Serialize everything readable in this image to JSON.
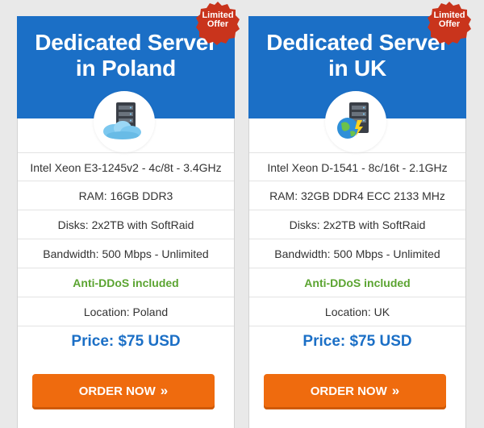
{
  "plans": [
    {
      "badge_line1": "Limited",
      "badge_line2": "Offer",
      "title_line1": "Dedicated Server",
      "title_line2": "in Poland",
      "icon": "server-cloud-icon",
      "specs": [
        "Intel Xeon E3-1245v2 - 4c/8t - 3.4GHz",
        "RAM: 16GB DDR3",
        "Disks: 2x2TB with SoftRaid",
        "Bandwidth: 500 Mbps - Unlimited",
        "Anti-DDoS included",
        "Location: Poland"
      ],
      "price": "Price: $75 USD",
      "order_label": "ORDER NOW",
      "order_chevron": "»"
    },
    {
      "badge_line1": "Limited",
      "badge_line2": "Offer",
      "title_line1": "Dedicated Server",
      "title_line2": "in UK",
      "icon": "server-globe-icon",
      "specs": [
        "Intel Xeon D-1541 - 8c/16t - 2.1GHz",
        "RAM: 32GB DDR4 ECC 2133 MHz",
        "Disks: 2x2TB with SoftRaid",
        "Bandwidth: 500 Mbps - Unlimited",
        "Anti-DDoS included",
        "Location: UK"
      ],
      "price": "Price: $75 USD",
      "order_label": "ORDER NOW",
      "order_chevron": "»"
    }
  ],
  "colors": {
    "header_blue": "#1b6fc6",
    "badge_red": "#c9341c",
    "ddos_green": "#5ba431",
    "order_orange": "#ef6b0e",
    "price_blue": "#1b6fc6"
  }
}
